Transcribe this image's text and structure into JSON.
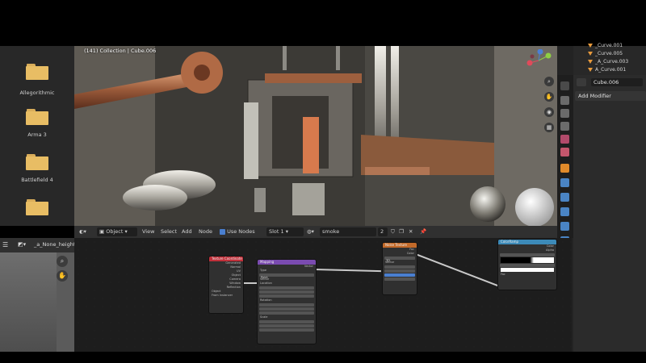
{
  "file_browser": {
    "folders": [
      {
        "label": ""
      },
      {
        "label": "Allegorithmic"
      },
      {
        "label": "Arma 3"
      },
      {
        "label": "Battlefield 4"
      },
      {
        "label": ""
      }
    ]
  },
  "viewport": {
    "collection_text": "(141) Collection | Cube.006",
    "axis_labels": {
      "y": "Y",
      "z": "Z",
      "x": "X"
    }
  },
  "outliner": {
    "items": [
      "_Curve.001",
      "_Curve.005",
      "_A_Curve.003",
      "A_Curve.001"
    ]
  },
  "properties": {
    "object_name": "Cube.006",
    "add_modifier": "Add Modifier"
  },
  "node_header": {
    "mode": "Object",
    "menu": [
      "View",
      "Select",
      "Add",
      "Node"
    ],
    "use_nodes_label": "Use Nodes",
    "slot": "Slot 1",
    "material": "smoke",
    "users": "2"
  },
  "image_editor": {
    "image_name": "_a_None_height"
  },
  "nodes": {
    "texture_coordinate": {
      "title": "Texture Coordinate",
      "outputs": [
        "Generated",
        "Normal",
        "UV",
        "Object",
        "Camera",
        "Window",
        "Reflection"
      ],
      "object_label": "Object",
      "from_instancer": "From Instancer"
    },
    "mapping": {
      "title": "Mapping",
      "type_label": "Type",
      "type_value": "Point",
      "vector": "Vector",
      "location": "Location",
      "rotation": "Rotation",
      "scale": "Scale",
      "loc": [
        "0 m",
        "0 m",
        "0 m"
      ],
      "rot": [
        "0°",
        "0°",
        "0°"
      ],
      "scl": [
        "1.000",
        "1.000",
        "1.000"
      ]
    },
    "noise_texture": {
      "title": "Noise Texture",
      "dimension": "3D",
      "outputs": [
        "Fac",
        "Color"
      ],
      "inputs": [
        "Vector",
        "Scale",
        "Detail",
        "Roughness",
        "Distortion"
      ],
      "values": [
        "0.200",
        "16.000",
        "0.607",
        "0.000"
      ]
    },
    "color_ramp": {
      "title": "ColorRamp",
      "outputs": [
        "Color",
        "Alpha"
      ],
      "interp": "Linear",
      "pos_label": "Pos",
      "pos_value": "0.384",
      "fac": "Fac"
    }
  }
}
